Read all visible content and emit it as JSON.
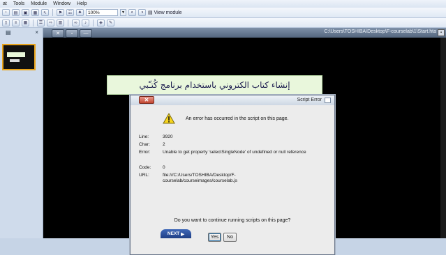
{
  "menu": [
    "at",
    "Tools",
    "Module",
    "Window",
    "Help"
  ],
  "toolbar": {
    "zoom": "100%",
    "view_module": "View module"
  },
  "left_panel": {
    "close": "×"
  },
  "hta": {
    "path": "C:\\Users\\TOSHIBA\\Desktop\\F-courselab\\1\\Start.hta"
  },
  "banner": {
    "text": "إنشاء كتاب الكتروني باستخدام برنامج كُتـّبي"
  },
  "dialog": {
    "title": "Script Error",
    "message": "An error has occurred in the script on this page.",
    "fields": [
      {
        "k": "Line:",
        "v": "3920"
      },
      {
        "k": "Char:",
        "v": "2"
      },
      {
        "k": "Error:",
        "v": "Unable to get property 'selectSingleNode' of undefined or null reference"
      },
      {
        "k": "Code:",
        "v": "0"
      },
      {
        "k": "URL:",
        "v": "file:///C:/Users/TOSHIBA/Desktop/F-courselab/courseimages/courselab.js"
      }
    ],
    "question": "Do you want to continue running scripts on this page?",
    "yes": "Yes",
    "no": "No"
  },
  "next": "NEXT"
}
